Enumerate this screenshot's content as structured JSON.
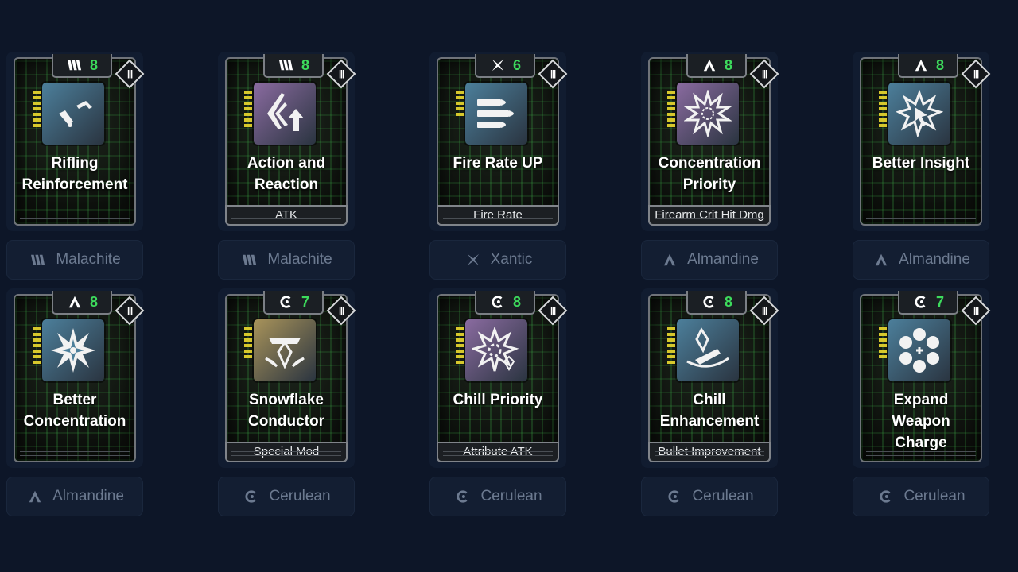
{
  "colors": {
    "background": "#0d1628",
    "cost_green": "#3ddb5c",
    "bar_yellow": "#d7c82c",
    "type_label": "#6c7a90"
  },
  "types": {
    "malachite": "Malachite",
    "xantic": "Xantic",
    "almandine": "Almandine",
    "cerulean": "Cerulean"
  },
  "mods": [
    {
      "name": "Rifling Reinforcement",
      "cost": "8",
      "type_icon": "malachite-icon",
      "type_label": "Malachite",
      "subtag": "",
      "art_icon": "bullet-arrow-icon",
      "art_color": "#4c7f9b",
      "bars": 7
    },
    {
      "name": "Action and Reaction",
      "cost": "8",
      "type_icon": "malachite-icon",
      "type_label": "Malachite",
      "subtag": "ATK",
      "art_icon": "action-reaction-icon",
      "art_color": "#8a6ba0",
      "bars": 7
    },
    {
      "name": "Fire Rate UP",
      "cost": "6",
      "type_icon": "xantic-icon",
      "type_label": "Xantic",
      "subtag": "Fire Rate",
      "art_icon": "triple-bullet-icon",
      "art_color": "#4c7f9b",
      "bars": 5
    },
    {
      "name": "Concentration Priority",
      "cost": "8",
      "type_icon": "almandine-icon",
      "type_label": "Almandine",
      "subtag": "Firearm Crit Hit Dmg",
      "art_icon": "target-burst-icon",
      "art_color": "#8a6ba0",
      "bars": 7
    },
    {
      "name": "Better Insight",
      "cost": "8",
      "type_icon": "almandine-icon",
      "type_label": "Almandine",
      "subtag": "",
      "art_icon": "cursor-burst-icon",
      "art_color": "#4c7f9b",
      "bars": 7
    },
    {
      "name": "Better Concentration",
      "cost": "8",
      "type_icon": "almandine-icon",
      "type_label": "Almandine",
      "subtag": "",
      "art_icon": "star-burst-icon",
      "art_color": "#4c7f9b",
      "bars": 7
    },
    {
      "name": "Snowflake Conductor",
      "cost": "7",
      "type_icon": "cerulean-icon",
      "type_label": "Cerulean",
      "subtag": "Special Mod",
      "art_icon": "snowflake-crystal-icon",
      "art_color": "#a8935a",
      "bars": 6
    },
    {
      "name": "Chill Priority",
      "cost": "8",
      "type_icon": "cerulean-icon",
      "type_label": "Cerulean",
      "subtag": "Attribute ATK",
      "art_icon": "chill-burst-icon",
      "art_color": "#8a6ba0",
      "bars": 7
    },
    {
      "name": "Chill Enhancement",
      "cost": "8",
      "type_icon": "cerulean-icon",
      "type_label": "Cerulean",
      "subtag": "Bullet Improvement",
      "art_icon": "crystal-bullet-icon",
      "art_color": "#4c7f9b",
      "bars": 7
    },
    {
      "name": "Expand Weapon Charge",
      "cost": "7",
      "type_icon": "cerulean-icon",
      "type_label": "Cerulean",
      "subtag": "",
      "art_icon": "revolver-cylinder-icon",
      "art_color": "#4c7f9b",
      "bars": 6
    }
  ]
}
